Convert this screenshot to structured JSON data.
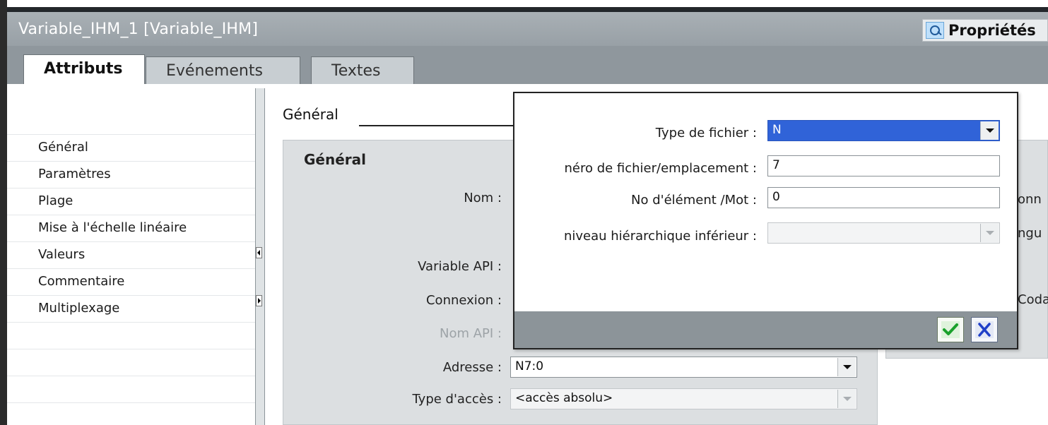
{
  "window": {
    "title": "Variable_IHM_1 [Variable_IHM]",
    "properties_label": "Propriétés"
  },
  "tabs": [
    {
      "label": "Attributs",
      "active": true
    },
    {
      "label": "Evénements",
      "active": false
    },
    {
      "label": "Textes",
      "active": false
    }
  ],
  "sidebar": {
    "items": [
      {
        "label": "Général"
      },
      {
        "label": "Paramètres"
      },
      {
        "label": "Plage"
      },
      {
        "label": "Mise à l'échelle linéaire"
      },
      {
        "label": "Valeurs"
      },
      {
        "label": "Commentaire"
      },
      {
        "label": "Multiplexage"
      }
    ]
  },
  "main": {
    "section_title": "Général",
    "group_title": "Général",
    "fields": {
      "name_label": "Nom :",
      "plc_variable_label": "Variable API :",
      "connection_label": "Connexion :",
      "plc_name_label": "Nom API :",
      "address_label": "Adresse :",
      "address_value": "N7:0",
      "access_type_label": "Type d'accès :",
      "access_type_value": "<accès absolu>"
    },
    "right_panel": {
      "fragment_1": "onn",
      "fragment_2": "ngu",
      "fragment_3": "Coda"
    }
  },
  "popup": {
    "file_type_label": "Type de fichier :",
    "file_type_value": "N",
    "file_number_label": "néro de fichier/emplacement :",
    "file_number_value": "7",
    "element_label": "No d'élément /Mot :",
    "element_value": "0",
    "sublevel_label": "niveau hiérarchique inférieur :",
    "sublevel_value": ""
  },
  "colors": {
    "title_bar": "#a3aaaf",
    "selection_blue": "#3063d8",
    "ok_green": "#1aa12c",
    "cancel_blue": "#1f3fc8"
  }
}
